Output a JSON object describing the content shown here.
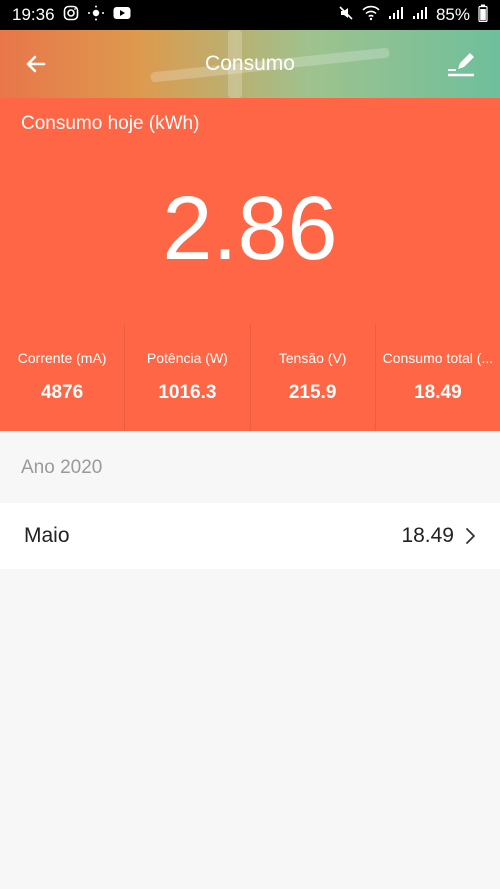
{
  "status_bar": {
    "time": "19:36",
    "battery": "85%"
  },
  "app_bar": {
    "title": "Consumo"
  },
  "hero": {
    "label": "Consumo hoje (kWh)",
    "value": "2.86"
  },
  "stats": [
    {
      "label": "Corrente (mA)",
      "value": "4876"
    },
    {
      "label": "Potência (W)",
      "value": "1016.3"
    },
    {
      "label": "Tensão (V)",
      "value": "215.9"
    },
    {
      "label": "Consumo total (...",
      "value": "18.49"
    }
  ],
  "history": {
    "year_label": "Ano 2020",
    "items": [
      {
        "month": "Maio",
        "value": "18.49"
      }
    ]
  },
  "icons": {
    "back": "arrow-left-icon",
    "edit": "edit-icon",
    "chevron": "chevron-right-icon"
  },
  "colors": {
    "accent": "#ff6645",
    "status_bar": "#000000"
  }
}
